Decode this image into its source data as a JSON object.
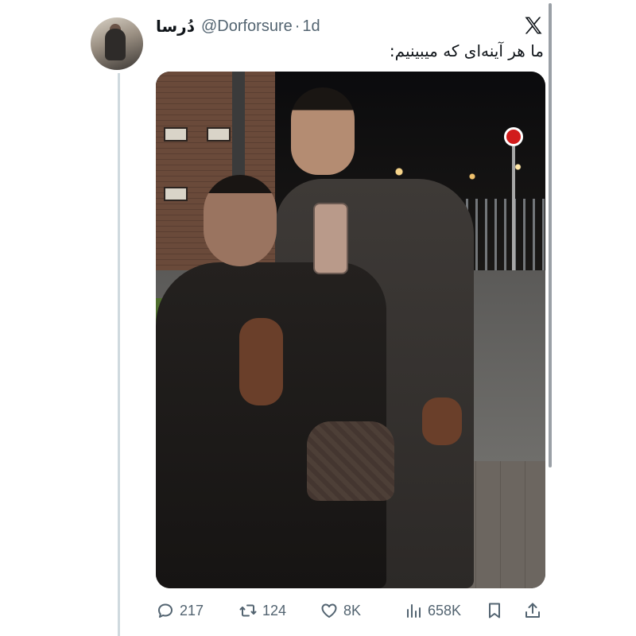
{
  "tweet": {
    "display_name": "دُرسا",
    "handle": "@Dorforsure",
    "separator": "·",
    "time": "1d",
    "text": "ما هر آینه‌ای که میبینیم:",
    "platform_logo": "x-logo-icon"
  },
  "actions": {
    "replies": "217",
    "reposts": "124",
    "likes": "8K",
    "views": "658K",
    "bookmark_icon": "bookmark-icon",
    "share_icon": "share-icon"
  },
  "colors": {
    "text_primary": "#0f1419",
    "text_secondary": "#536471",
    "thread_line": "#cfd9de"
  }
}
